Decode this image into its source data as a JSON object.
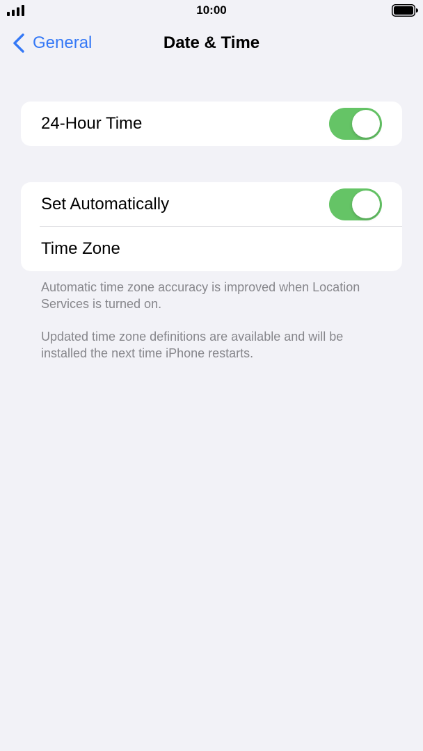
{
  "status_bar": {
    "time": "10:00",
    "signal_icon": "cellular-signal-icon",
    "battery_icon": "battery-full-icon"
  },
  "nav": {
    "back_label": "General",
    "back_icon": "chevron-left-icon",
    "title": "Date & Time"
  },
  "colors": {
    "accent": "#3478f6",
    "toggle_on": "#65c466",
    "background": "#f2f2f7",
    "footnote": "#86868b"
  },
  "settings": {
    "hour24": {
      "label": "24-Hour Time",
      "enabled": true
    },
    "set_automatically": {
      "label": "Set Automatically",
      "enabled": true
    },
    "time_zone": {
      "label": "Time Zone"
    }
  },
  "footnotes": [
    "Automatic time zone accuracy is improved when Location Services is turned on.",
    "Updated time zone definitions are available and will be installed the next time iPhone restarts."
  ]
}
